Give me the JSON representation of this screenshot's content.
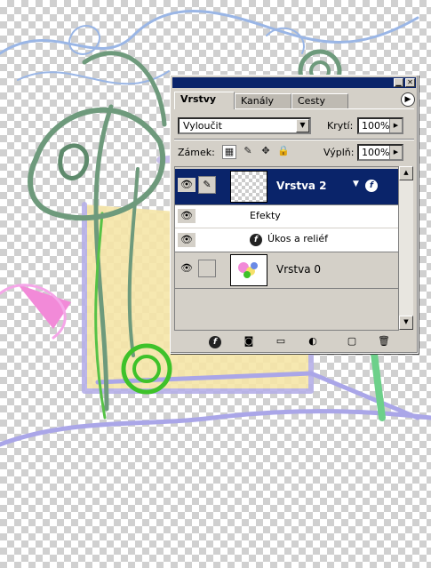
{
  "palette": {
    "tabs": [
      {
        "label": "Vrstvy",
        "active": true
      },
      {
        "label": "Kanály",
        "active": false
      },
      {
        "label": "Cesty",
        "active": false
      }
    ],
    "blend_mode": "Vyloučit",
    "opacity_label": "Krytí:",
    "opacity_value": "100%",
    "lock_label": "Zámek:",
    "fill_label": "Výplň:",
    "fill_value": "100%",
    "layers": [
      {
        "name": "Vrstva 2",
        "selected": true,
        "visible": true
      },
      {
        "name": "Efekty",
        "type": "effects-header",
        "visible": true
      },
      {
        "name": "Úkos a reliéf",
        "type": "effect",
        "visible": true
      },
      {
        "name": "Vrstva 0",
        "selected": false,
        "visible": true
      }
    ]
  },
  "icons": {
    "eye": "eye-icon",
    "brush": "brush-icon",
    "fx": "layer-style-icon",
    "palette_menu": "palette-menu-arrow-icon"
  },
  "colors": {
    "titlebar": "#0a246a",
    "selected_row": "#0a246a",
    "panel_bg": "#d4d0c8"
  }
}
